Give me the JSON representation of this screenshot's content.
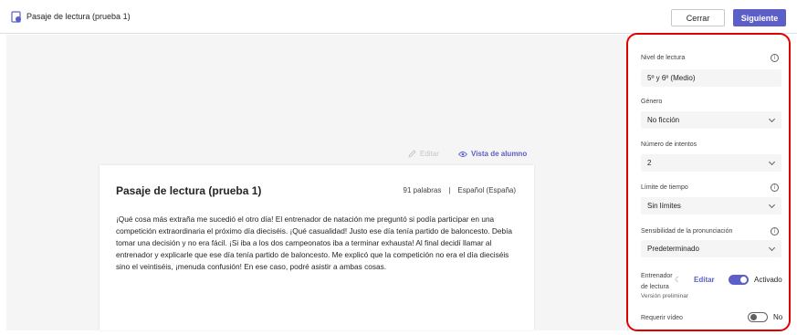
{
  "header": {
    "title": "Pasaje de lectura (prueba 1)",
    "close_label": "Cerrar",
    "next_label": "Siguiente"
  },
  "toolbar": {
    "edit_label": "Editar",
    "student_view_label": "Vista de alumno"
  },
  "passage": {
    "title": "Pasaje de lectura (prueba 1)",
    "word_count": "91 palabras",
    "separator": "|",
    "language": "Español (España)",
    "body": "¡Qué cosa más extraña me sucedió el otro día! El entrenador de natación me preguntó si podía participar en una competición extraordinaria el próximo día dieciséis. ¡Qué casualidad! Justo ese día tenía partido de baloncesto. Debía tomar una decisión y no era fácil. ¡Si iba a los dos campeonatos iba a terminar exhausta! Al final decidí llamar al entrenador y explicarle que ese día tenía partido de baloncesto. Me explicó que la competición no era el día dieciséis sino el veintiséis, ¡menuda confusión! En ese caso, podré asistir a ambas cosas."
  },
  "settings": {
    "reading_level": {
      "label": "Nivel de lectura",
      "value": "5º y 6º (Medio)"
    },
    "genre": {
      "label": "Género",
      "value": "No ficción"
    },
    "attempts": {
      "label": "Número de intentos",
      "value": "2"
    },
    "time_limit": {
      "label": "Límite de tiempo",
      "value": "Sin límites"
    },
    "pronunciation": {
      "label": "Sensibilidad de la pronunciación",
      "value": "Predeterminado"
    },
    "coach": {
      "label_line1": "Entrenador",
      "label_line2": "de lectura",
      "edit_label": "Editar",
      "state_label": "Activado",
      "enabled": true,
      "preview_label": "Versión preliminar"
    },
    "video": {
      "label": "Requerir vídeo",
      "state_label": "No",
      "enabled": false
    }
  },
  "colors": {
    "accent": "#5b5fc7",
    "highlight_frame": "#e00000"
  }
}
